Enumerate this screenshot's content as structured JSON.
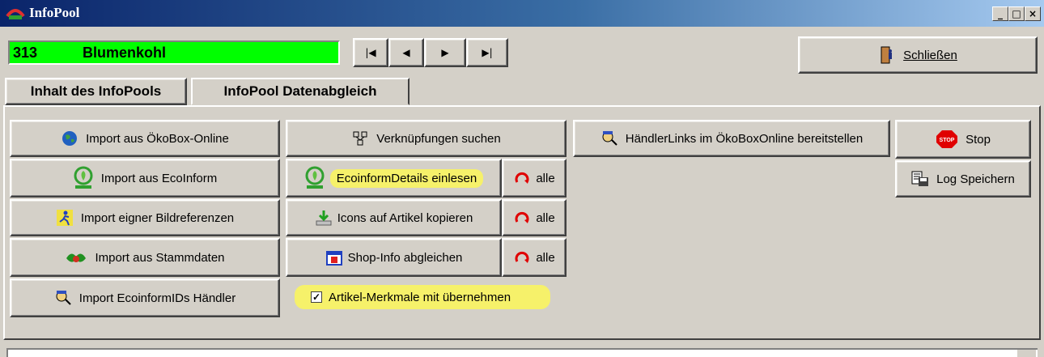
{
  "window": {
    "title": "InfoPool",
    "minimize": "_",
    "maximize": "□",
    "close": "×"
  },
  "record": {
    "number": "313",
    "name": "Blumenkohl"
  },
  "nav": {
    "first": "|◀",
    "prev": "◀",
    "next": "▶",
    "last": "▶|"
  },
  "close_button": {
    "label": "Schließen"
  },
  "tabs": [
    {
      "label": "Inhalt des InfoPools"
    },
    {
      "label": "InfoPool Datenabgleich"
    }
  ],
  "left_buttons": [
    {
      "label": "Import aus ÖkoBox-Online"
    },
    {
      "label": "Import aus EcoInform"
    },
    {
      "label": "Import eigner Bildreferenzen"
    },
    {
      "label": "Import aus Stammdaten"
    },
    {
      "label": "Import EcoinformIDs Händler"
    }
  ],
  "middle_buttons": [
    {
      "label": "Verknüpfungen suchen"
    },
    {
      "label": "EcoinformDetails einlesen",
      "alle": "alle"
    },
    {
      "label": "Icons auf Artikel kopieren",
      "alle": "alle"
    },
    {
      "label": "Shop-Info abgleichen",
      "alle": "alle"
    }
  ],
  "checkbox": {
    "label": "Artikel-Merkmale mit übernehmen",
    "checked": "✓"
  },
  "haendler_button": {
    "label": "HändlerLinks im ÖkoBoxOnline bereitstellen"
  },
  "stop_button": {
    "label": "Stop",
    "icon_text": "STOP"
  },
  "log_button": {
    "label": "Log Speichern"
  },
  "colors": {
    "record_bg": "#00ff00",
    "highlight": "#f6f16a",
    "title_start": "#0a246a",
    "stop_red": "#e00000"
  }
}
